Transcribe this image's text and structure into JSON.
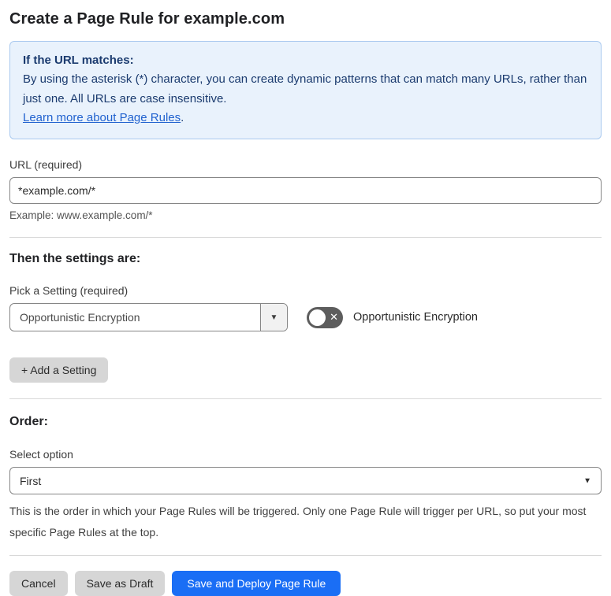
{
  "page": {
    "title": "Create a Page Rule for example.com"
  },
  "info_box": {
    "heading": "If the URL matches:",
    "body": "By using the asterisk (*) character, you can create dynamic patterns that can match many URLs, rather than just one. All URLs are case insensitive.",
    "link_label": "Learn more about Page Rules",
    "link_suffix": "."
  },
  "url_field": {
    "label": "URL (required)",
    "value": "*example.com/*",
    "helper": "Example: www.example.com/*"
  },
  "settings_section": {
    "heading": "Then the settings are:",
    "setting_label": "Pick a Setting (required)",
    "setting_value": "Opportunistic Encryption",
    "dropdown_caret": "▼",
    "toggle": {
      "state": "off",
      "icon": "✕",
      "label": "Opportunistic Encryption"
    },
    "add_button_label": "+ Add a Setting"
  },
  "order_section": {
    "heading": "Order:",
    "select_label": "Select option",
    "select_value": "First",
    "select_caret": "▼",
    "helper": "This is the order in which your Page Rules will be triggered. Only one Page Rule will trigger per URL, so put your most specific Page Rules at the top."
  },
  "footer": {
    "cancel_label": "Cancel",
    "save_draft_label": "Save as Draft",
    "save_deploy_label": "Save and Deploy Page Rule"
  },
  "colors": {
    "accent_blue": "#1a6ef5",
    "info_bg": "#e9f2fc",
    "info_border": "#aac9ef",
    "info_text": "#1b3b6f",
    "link_blue": "#2162cf",
    "toggle_off_gray": "#5d5d5d",
    "button_gray": "#d6d6d6"
  }
}
